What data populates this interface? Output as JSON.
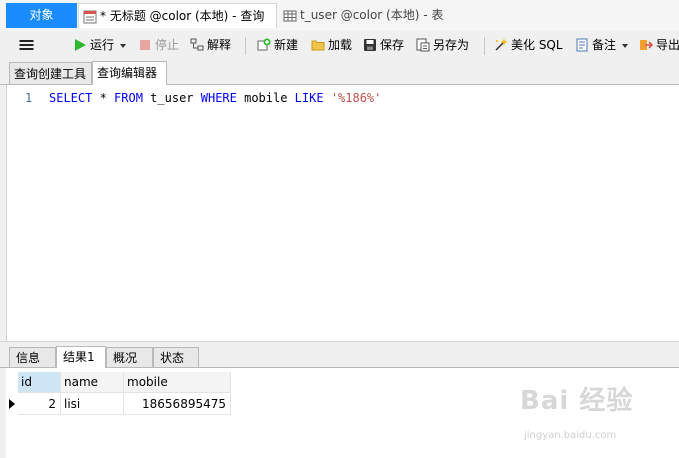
{
  "tabs": {
    "objects": "对象",
    "query": "* 无标题 @color (本地) - 查询",
    "table": "t_user @color (本地) - 表"
  },
  "toolbar": {
    "run": "运行",
    "stop": "停止",
    "explain": "解释",
    "new": "新建",
    "load": "加载",
    "save": "保存",
    "save_as": "另存为",
    "beautify": "美化 SQL",
    "comment": "备注",
    "export": "导出"
  },
  "subtabs": {
    "builder": "查询创建工具",
    "editor": "查询编辑器"
  },
  "editor": {
    "line_number": "1",
    "tokens": {
      "select": "SELECT",
      "star": " * ",
      "from": "FROM",
      "table": " t_user ",
      "where": "WHERE",
      "column": " mobile ",
      "like": "LIKE",
      "space": " ",
      "pattern": "'%186%'"
    }
  },
  "result_tabs": {
    "info": "信息",
    "result1": "结果1",
    "overview": "概况",
    "status": "状态"
  },
  "grid": {
    "headers": [
      "id",
      "name",
      "mobile"
    ],
    "rows": [
      [
        "2",
        "lisi",
        "18656895475"
      ]
    ]
  },
  "watermark": {
    "logo": "Bai 经验",
    "url": "jingyan.baidu.com"
  },
  "colors": {
    "accent": "#1a8cff",
    "keyword": "#0000ff",
    "string": "#c0504d"
  }
}
